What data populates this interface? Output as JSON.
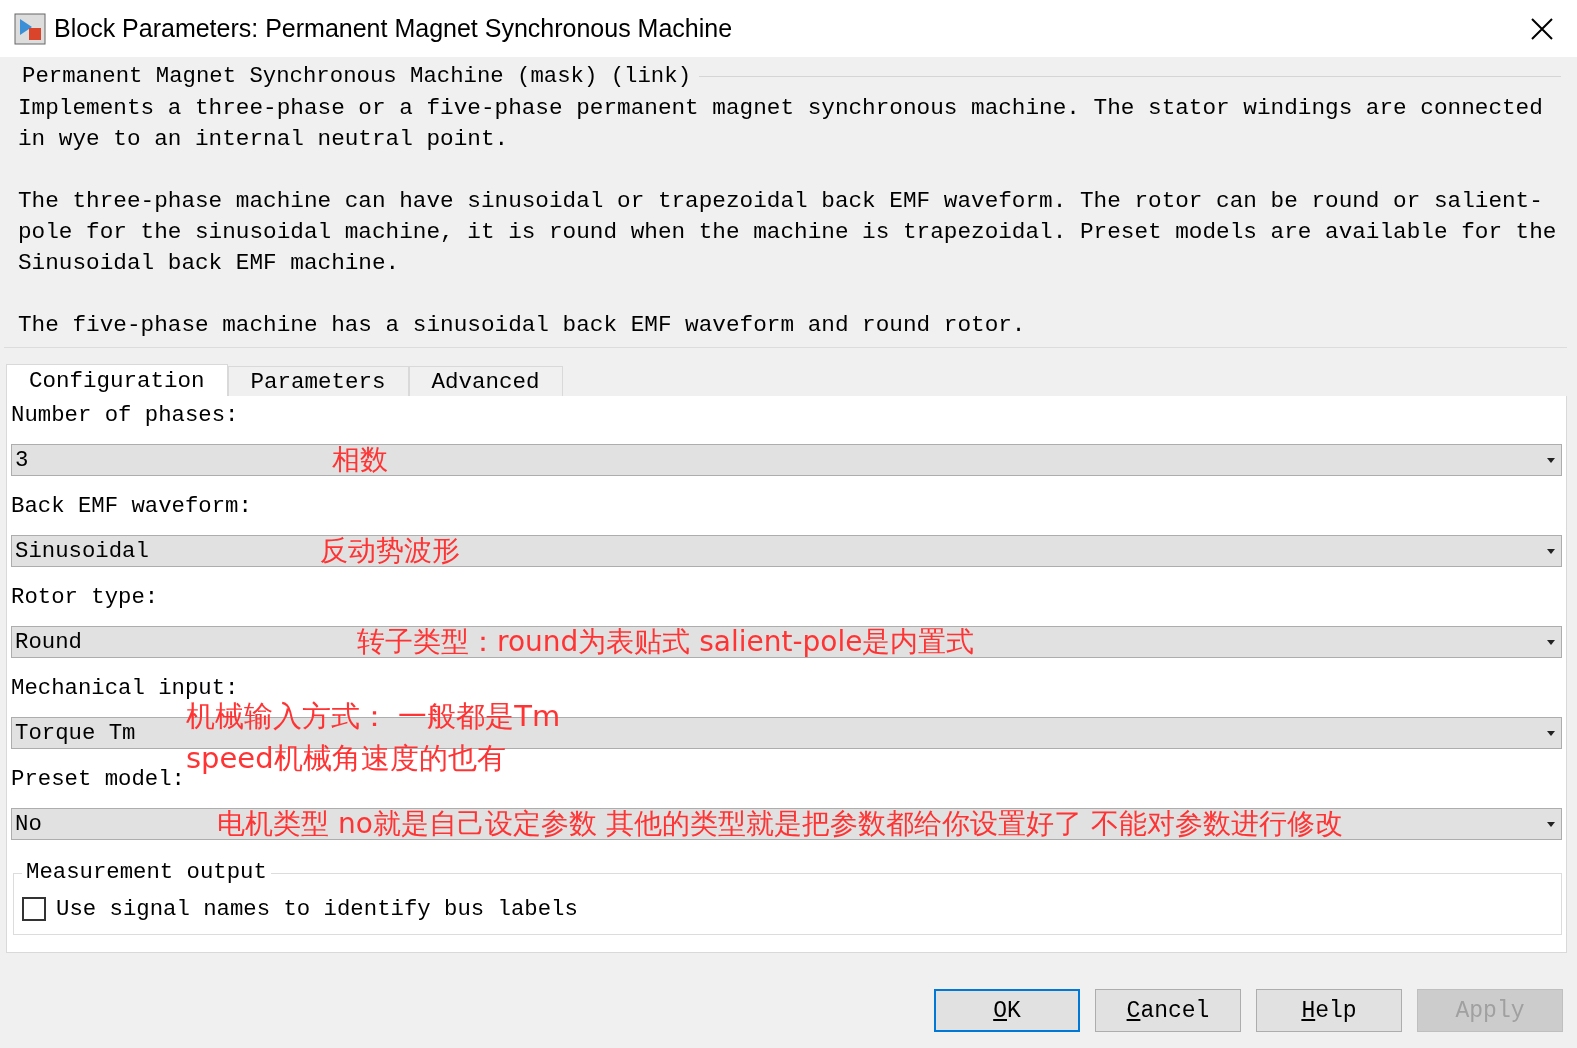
{
  "window": {
    "title": "Block Parameters: Permanent Magnet Synchronous Machine"
  },
  "header": {
    "title": "Permanent Magnet Synchronous Machine (mask) (link)",
    "paragraphs": [
      "Implements a three-phase or a five-phase permanent magnet synchronous machine. The stator windings are connected in wye to an internal neutral point.",
      "The three-phase machine can have sinusoidal or trapezoidal back EMF waveform. The rotor can be round or salient-pole for the sinusoidal machine, it is round when the machine is trapezoidal. Preset models are available for the Sinusoidal back EMF machine.",
      "The five-phase machine has a sinusoidal back EMF waveform and round rotor."
    ]
  },
  "tabs": [
    {
      "label": "Configuration",
      "selected": true
    },
    {
      "label": "Parameters",
      "selected": false
    },
    {
      "label": "Advanced",
      "selected": false
    }
  ],
  "fields": [
    {
      "label": "Number of phases:",
      "value": "3",
      "annotation": [
        "相数"
      ]
    },
    {
      "label": "Back EMF waveform:",
      "value": "Sinusoidal",
      "annotation": [
        "反动势波形"
      ]
    },
    {
      "label": "Rotor type:",
      "value": "Round",
      "annotation": [
        "转子类型：round为表贴式 salient-pole是内置式"
      ]
    },
    {
      "label": "Mechanical input:",
      "value": "Torque Tm",
      "annotation": [
        "机械输入方式： 一般都是Tm",
        "speed机械角速度的也有"
      ]
    },
    {
      "label": "Preset model:",
      "value": "No",
      "annotation": [
        "电机类型 no就是自己设定参数 其他的类型就是把参数都给你设置好了 不能对参数进行修改"
      ]
    }
  ],
  "group": {
    "title": "Measurement output",
    "checkbox": {
      "label": "Use signal names to identify bus labels",
      "checked": false
    }
  },
  "buttons": [
    {
      "label": "OK",
      "mnemonic_underlined": true,
      "disabled": false,
      "default": true
    },
    {
      "label": "Cancel",
      "mnemonic_underlined": true,
      "disabled": false,
      "default": false
    },
    {
      "label": "Help",
      "mnemonic_underlined": true,
      "disabled": false,
      "default": false
    },
    {
      "label": "Apply",
      "mnemonic_underlined": false,
      "disabled": true,
      "default": false
    }
  ]
}
